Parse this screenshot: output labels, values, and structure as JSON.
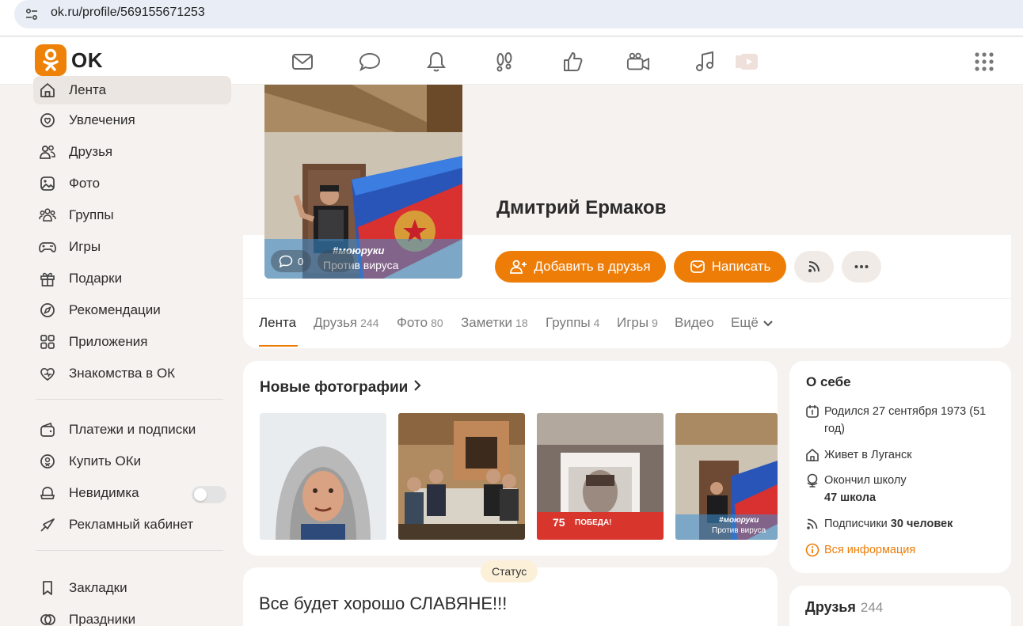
{
  "browser": {
    "url": "ok.ru/profile/569155671253"
  },
  "header": {
    "logo_text": "OK",
    "brand_color": "#ee8208"
  },
  "sidebar": {
    "items": [
      {
        "label": "Лента",
        "icon": "home-icon"
      },
      {
        "label": "Увлечения",
        "icon": "hobby-icon"
      },
      {
        "label": "Друзья",
        "icon": "friends-icon"
      },
      {
        "label": "Фото",
        "icon": "photo-icon"
      },
      {
        "label": "Группы",
        "icon": "groups-icon"
      },
      {
        "label": "Игры",
        "icon": "gamepad-icon"
      },
      {
        "label": "Подарки",
        "icon": "gift-icon"
      },
      {
        "label": "Рекомендации",
        "icon": "compass-icon"
      },
      {
        "label": "Приложения",
        "icon": "apps-icon"
      },
      {
        "label": "Знакомства в ОК",
        "icon": "dating-icon"
      }
    ],
    "items2": [
      {
        "label": "Платежи и подписки",
        "icon": "wallet-icon"
      },
      {
        "label": "Купить ОКи",
        "icon": "coin-icon"
      },
      {
        "label": "Невидимка",
        "icon": "invisible-icon"
      },
      {
        "label": "Рекламный кабинет",
        "icon": "ads-icon"
      }
    ],
    "items3": [
      {
        "label": "Закладки",
        "icon": "bookmark-icon"
      },
      {
        "label": "Праздники",
        "icon": "holiday-icon"
      }
    ]
  },
  "profile": {
    "name": "Дмитрий Ермаков",
    "avatar_comments": "0",
    "avatar_caption_tag": "#моюруки",
    "avatar_caption_text": "Против вируса",
    "add_friend_label": "Добавить в друзья",
    "write_label": "Написать"
  },
  "tabs": [
    {
      "label": "Лента",
      "count": ""
    },
    {
      "label": "Друзья",
      "count": "244"
    },
    {
      "label": "Фото",
      "count": "80"
    },
    {
      "label": "Заметки",
      "count": "18"
    },
    {
      "label": "Группы",
      "count": "4"
    },
    {
      "label": "Игры",
      "count": "9"
    },
    {
      "label": "Видео",
      "count": ""
    },
    {
      "label": "Ещё",
      "count": ""
    }
  ],
  "new_photos": {
    "title": "Новые фотографии",
    "thumb3_text": "ПОБЕДА!",
    "thumb3_number": "75",
    "thumb4_tag": "#моюруки",
    "thumb4_text": "Против вируса"
  },
  "about": {
    "title": "О себе",
    "born": "Родился 27 сентября 1973 (51 год)",
    "lives_prefix": "Живет в ",
    "lives_city": "Луганск",
    "school_prefix": "Окончил школу",
    "school_name": "47 школа",
    "subs_prefix": "Подписчики ",
    "subs_count": "30 человек",
    "all_info": "Вся информация"
  },
  "status": {
    "badge": "Статус",
    "text": "Все будет хорошо СЛАВЯНЕ!!!"
  },
  "friends": {
    "title": "Друзья",
    "count": "244"
  }
}
